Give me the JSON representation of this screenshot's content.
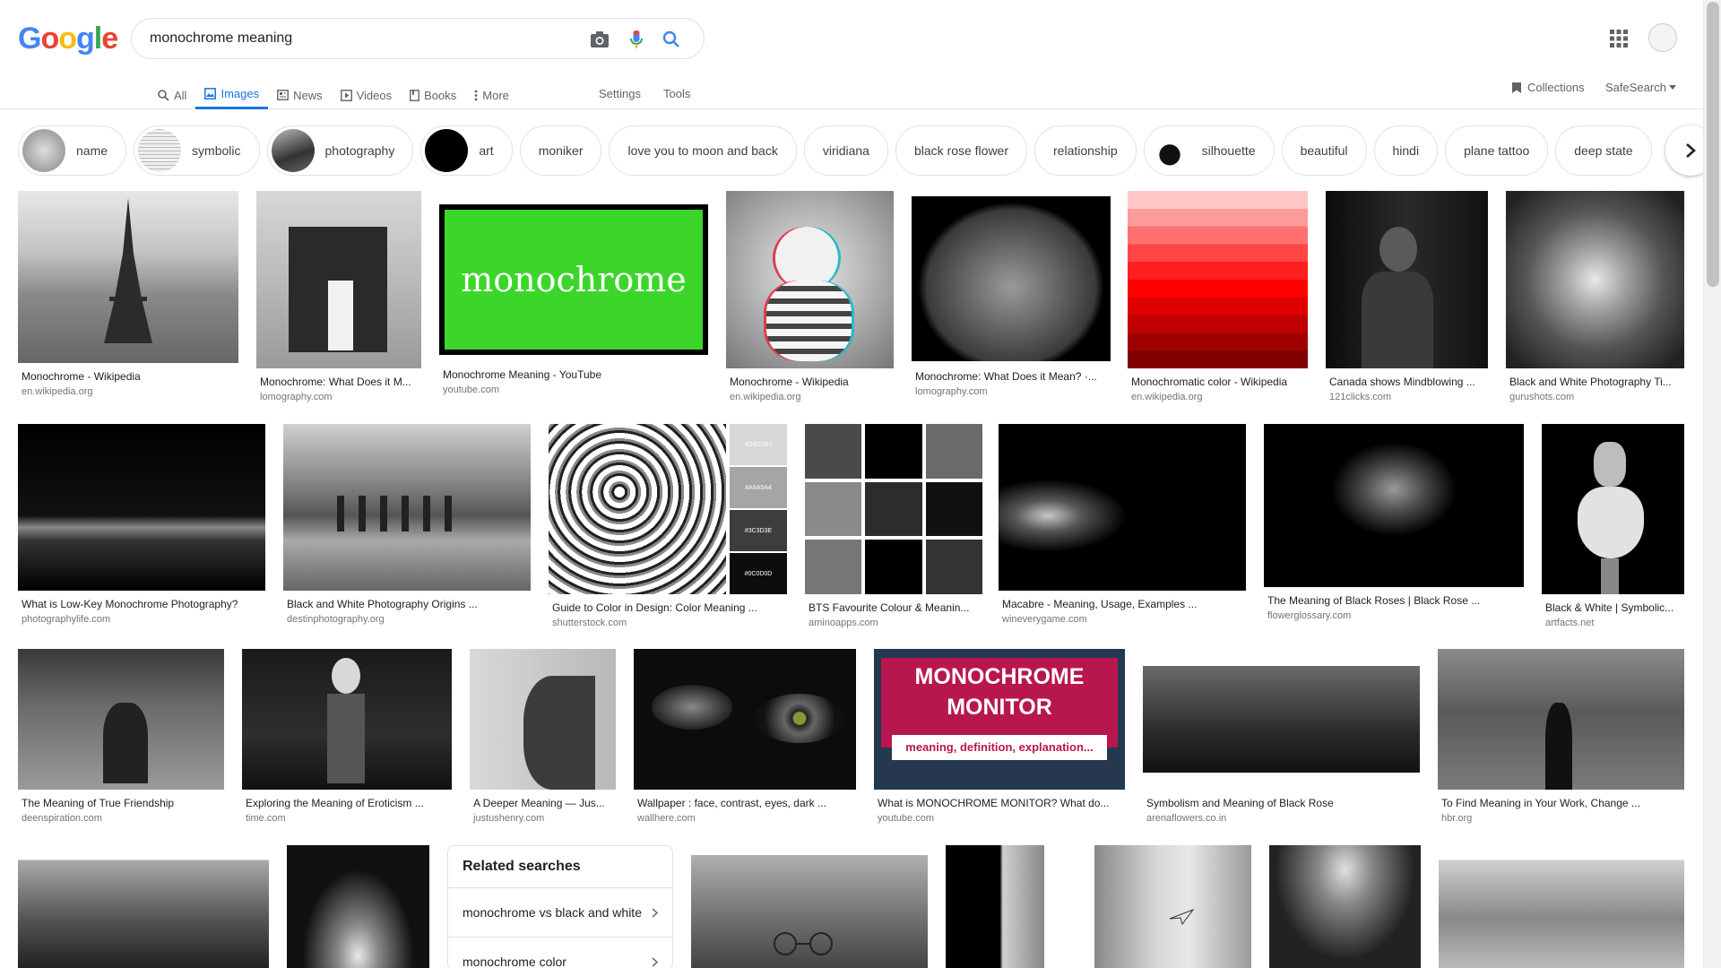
{
  "logo": {
    "letters": [
      "G",
      "o",
      "o",
      "g",
      "l",
      "e"
    ]
  },
  "search": {
    "query": "monochrome meaning"
  },
  "tabs": [
    "All",
    "Images",
    "News",
    "Videos",
    "Books",
    "More"
  ],
  "settings_label": "Settings",
  "tools_label": "Tools",
  "collections_label": "Collections",
  "safesearch_label": "SafeSearch",
  "chips": [
    "name",
    "symbolic",
    "photography",
    "art",
    "moniker",
    "love you to moon and back",
    "viridiana",
    "black rose flower",
    "relationship",
    "silhouette",
    "beautiful",
    "hindi",
    "plane tattoo",
    "deep state"
  ],
  "results": [
    {
      "title": "Monochrome - Wikipedia",
      "source": "en.wikipedia.org"
    },
    {
      "title": "Monochrome: What Does it M...",
      "source": "lomography.com"
    },
    {
      "title": "Monochrome Meaning - YouTube",
      "source": "youtube.com",
      "overlay": "monochrome"
    },
    {
      "title": "Monochrome - Wikipedia",
      "source": "en.wikipedia.org"
    },
    {
      "title": "Monochrome: What Does it Mean? ·...",
      "source": "lomography.com"
    },
    {
      "title": "Monochromatic color - Wikipedia",
      "source": "en.wikipedia.org"
    },
    {
      "title": "Canada shows Mindblowing ...",
      "source": "121clicks.com"
    },
    {
      "title": "Black and White Photography Ti...",
      "source": "gurushots.com"
    },
    {
      "title": "What is Low-Key Monochrome Photography?",
      "source": "photographylife.com"
    },
    {
      "title": "Black and White Photography Origins ...",
      "source": "destinphotography.org"
    },
    {
      "title": "Guide to Color in Design: Color Meaning ...",
      "source": "shutterstock.com",
      "swatches": [
        "#D8D7D7",
        "#A6A5A4",
        "#3C3D3E",
        "#0C0D0D"
      ]
    },
    {
      "title": "BTS Favourite Colour & Meanin...",
      "source": "aminoapps.com"
    },
    {
      "title": "Macabre - Meaning, Usage, Examples ...",
      "source": "wineverygame.com"
    },
    {
      "title": "The Meaning of Black Roses | Black Rose ...",
      "source": "flowerglossary.com"
    },
    {
      "title": "Black & White | Symbolic...",
      "source": "artfacts.net"
    },
    {
      "title": "The Meaning of True Friendship",
      "source": "deenspiration.com"
    },
    {
      "title": "Exploring the Meaning of Eroticism ...",
      "source": "time.com"
    },
    {
      "title": "A Deeper Meaning — Jus...",
      "source": "justushenry.com"
    },
    {
      "title": "Wallpaper : face, contrast, eyes, dark ...",
      "source": "wallhere.com"
    },
    {
      "title": "What is MONOCHROME MONITOR? What do...",
      "source": "youtube.com",
      "overlay_lines": [
        "MONOCHROME",
        "MONITOR",
        "meaning, definition, explanation..."
      ]
    },
    {
      "title": "Symbolism and Meaning of Black Rose",
      "source": "arenaflowers.co.in"
    },
    {
      "title": "To Find Meaning in Your Work, Change ...",
      "source": "hbr.org"
    }
  ],
  "related": {
    "title": "Related searches",
    "items": [
      "monochrome vs black and white",
      "monochrome color"
    ]
  },
  "colors": {
    "blue": "#4285F4",
    "red": "#EA4335",
    "yellow": "#FBBC05",
    "green": "#34A853",
    "accent": "#1a73e8"
  }
}
